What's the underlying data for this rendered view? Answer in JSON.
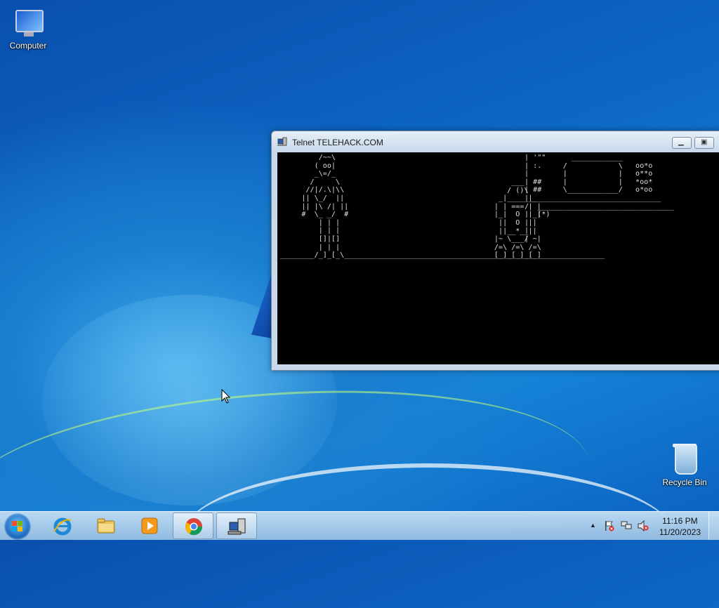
{
  "desktop": {
    "icons": [
      {
        "label": "Computer",
        "icon": "computer-icon"
      },
      {
        "label": "Recycle Bin",
        "icon": "recycle-bin-icon"
      }
    ]
  },
  "window": {
    "title": "Telnet TELEHACK.COM",
    "icon": "telnet-icon",
    "buttons": {
      "minimize": "minimize",
      "maximize": "maximize"
    },
    "console_text": "         /~~\\\n        ( oo|\n        _\\=/_\n       /     \\\n      //|/.\\|\\\\\n     || \\_/  ||\n     || |\\ /| ||\n     #  \\_ _/  #\n         | | |\n         | | |\n         []|[]\n         | | |\n________/_]_[_\\_____________________________________________________________\n",
    "console_art_r2": "                ___\n               / ()\\\n             _|_____|_\n            | | === | |\n            |_|  O  |_|\n             ||  O  ||\n             ||__*__||\n            |~ \\___/ ~|\n            /=\\ /=\\ /=\\\n            [_]_[_]_[_]",
    "console_art_ship": "| '\"\"      ____________\n| :.     /            \\   oo*o\n|        |            |   o**o\n| ##     |            |   *oo*\n| ##     \\____________/   o*oo\n|_______________________________\n/  ________________________________\n|  (*)\n|\n|\n|"
  },
  "taskbar": {
    "start_icon": "windows-start-icon",
    "pinned": [
      {
        "name": "internet-explorer",
        "icon": "internet-explorer-icon"
      },
      {
        "name": "file-explorer",
        "icon": "folder-icon"
      },
      {
        "name": "media-player",
        "icon": "media-player-icon"
      },
      {
        "name": "chrome",
        "icon": "chrome-icon"
      },
      {
        "name": "telnet",
        "icon": "telnet-icon"
      }
    ],
    "tray": {
      "expand": "▲",
      "time": "11:16 PM",
      "date": "11/20/2023"
    }
  },
  "colors": {
    "accent": "#1584d8",
    "console_bg": "#000000",
    "console_fg": "#dedede"
  }
}
